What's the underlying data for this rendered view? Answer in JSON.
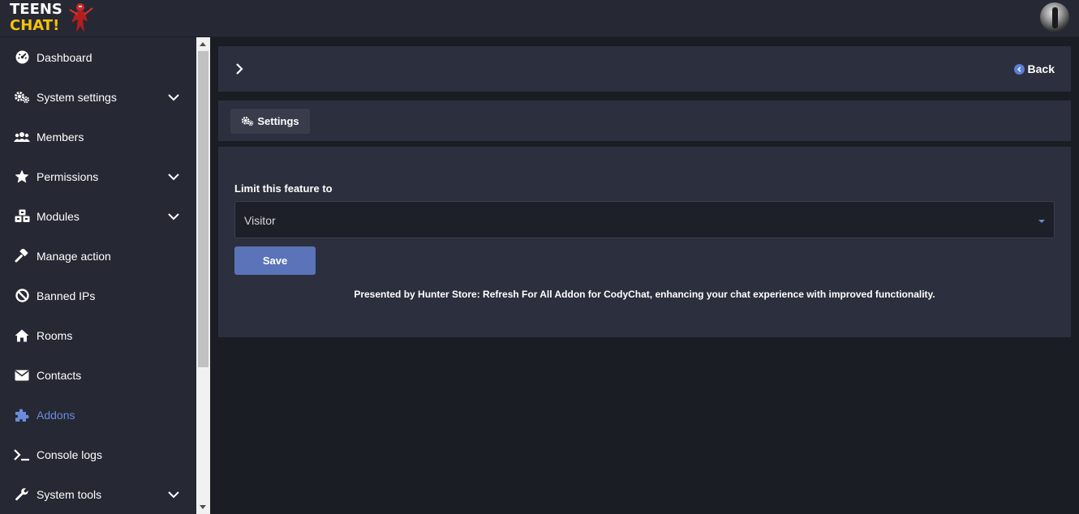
{
  "header": {
    "logo_line1": "TEENS",
    "logo_line2": "CHAT!",
    "avatar_icon": "user-avatar"
  },
  "sidebar": {
    "items": [
      {
        "label": "Dashboard",
        "icon": "dashboard-icon",
        "has_submenu": false
      },
      {
        "label": "System settings",
        "icon": "gears-icon",
        "has_submenu": true
      },
      {
        "label": "Members",
        "icon": "users-icon",
        "has_submenu": false
      },
      {
        "label": "Permissions",
        "icon": "star-icon",
        "has_submenu": true
      },
      {
        "label": "Modules",
        "icon": "cubes-icon",
        "has_submenu": true
      },
      {
        "label": "Manage action",
        "icon": "gavel-icon",
        "has_submenu": false
      },
      {
        "label": "Banned IPs",
        "icon": "ban-icon",
        "has_submenu": false
      },
      {
        "label": "Rooms",
        "icon": "home-icon",
        "has_submenu": false
      },
      {
        "label": "Contacts",
        "icon": "envelope-icon",
        "has_submenu": false
      },
      {
        "label": "Addons",
        "icon": "puzzle-icon",
        "has_submenu": false,
        "active": true
      },
      {
        "label": "Console logs",
        "icon": "terminal-icon",
        "has_submenu": false
      },
      {
        "label": "System tools",
        "icon": "wrench-icon",
        "has_submenu": true
      }
    ]
  },
  "panel": {
    "back_label": "Back",
    "tab_label": "Settings"
  },
  "form": {
    "limit_label": "Limit this feature to",
    "limit_value": "Visitor",
    "save_label": "Save",
    "footnote": "Presented by Hunter Store: Refresh For All Addon for CodyChat, enhancing your chat experience with improved functionality."
  },
  "colors": {
    "background": "#1b1d25",
    "panel": "#2c2f3d",
    "sidebar": "#262833",
    "accent": "#6a8bdc",
    "save_button": "#5b73b8"
  }
}
